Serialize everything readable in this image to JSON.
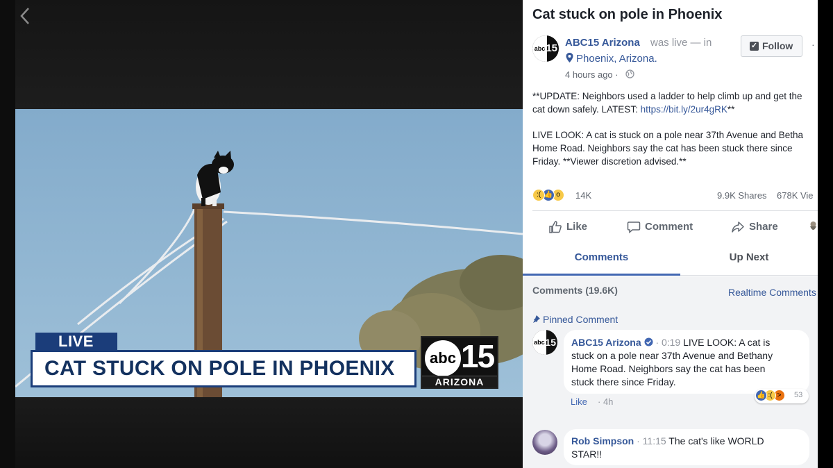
{
  "video": {
    "live_label": "LIVE",
    "banner_text": "CAT STUCK ON POLE IN PHOENIX",
    "logo_abc": "abc",
    "logo_number": "15",
    "logo_region": "ARIZONA",
    "icons": {
      "back": "chevron-left-icon"
    }
  },
  "post": {
    "title": "Cat stuck on pole in Phoenix",
    "page_name": "ABC15 Arizona",
    "was_live": "was live — in",
    "location": "Phoenix, Arizona.",
    "time": "4 hours ago ·",
    "follow_label": "Follow",
    "more": "·",
    "update_line1": "**UPDATE: Neighbors used a ladder to help climb up and get the",
    "update_line2_pre": "cat down safely. LATEST: ",
    "update_link": "https://bit.ly/2ur4gRK",
    "update_line2_post": "**",
    "live_line1": "LIVE LOOK: A cat is stuck on a pole near 37th Avenue and Betha",
    "live_line2": "Home Road. Neighbors say the cat has been stuck there since",
    "live_line3": "Friday. **Viewer discretion advised.**",
    "avatar_abc": "abc",
    "avatar_15": "15"
  },
  "stats": {
    "reactions": "14K",
    "shares": "9.9K Shares",
    "views": "678K Vie"
  },
  "actions": {
    "like": "Like",
    "comment": "Comment",
    "share": "Share"
  },
  "tabs": {
    "comments": "Comments",
    "up_next": "Up Next"
  },
  "comments": {
    "count_label": "Comments (19.6K)",
    "realtime_label": "Realtime Comments",
    "pinned_label": "Pinned Comment",
    "items": [
      {
        "author": "ABC15 Arizona",
        "timestamp": "· 0:19",
        "line1": " LIVE LOOK: A cat is",
        "line2": "stuck on a pole near 37th Avenue and Bethany",
        "line3": "Home Road. Neighbors say the cat has been",
        "line4": "stuck there since Friday.",
        "like_label": "Like",
        "age": "· 4h",
        "reaction_count": "53"
      },
      {
        "author": "Rob Simpson",
        "timestamp": "· 11:15",
        "line1": " The cat's like WORLD",
        "line2": "STAR!!"
      }
    ]
  },
  "colors": {
    "link": "#365899",
    "accent": "#4267b2",
    "banner_blue": "#1b3d7a",
    "sky": "#8fb4d0"
  }
}
